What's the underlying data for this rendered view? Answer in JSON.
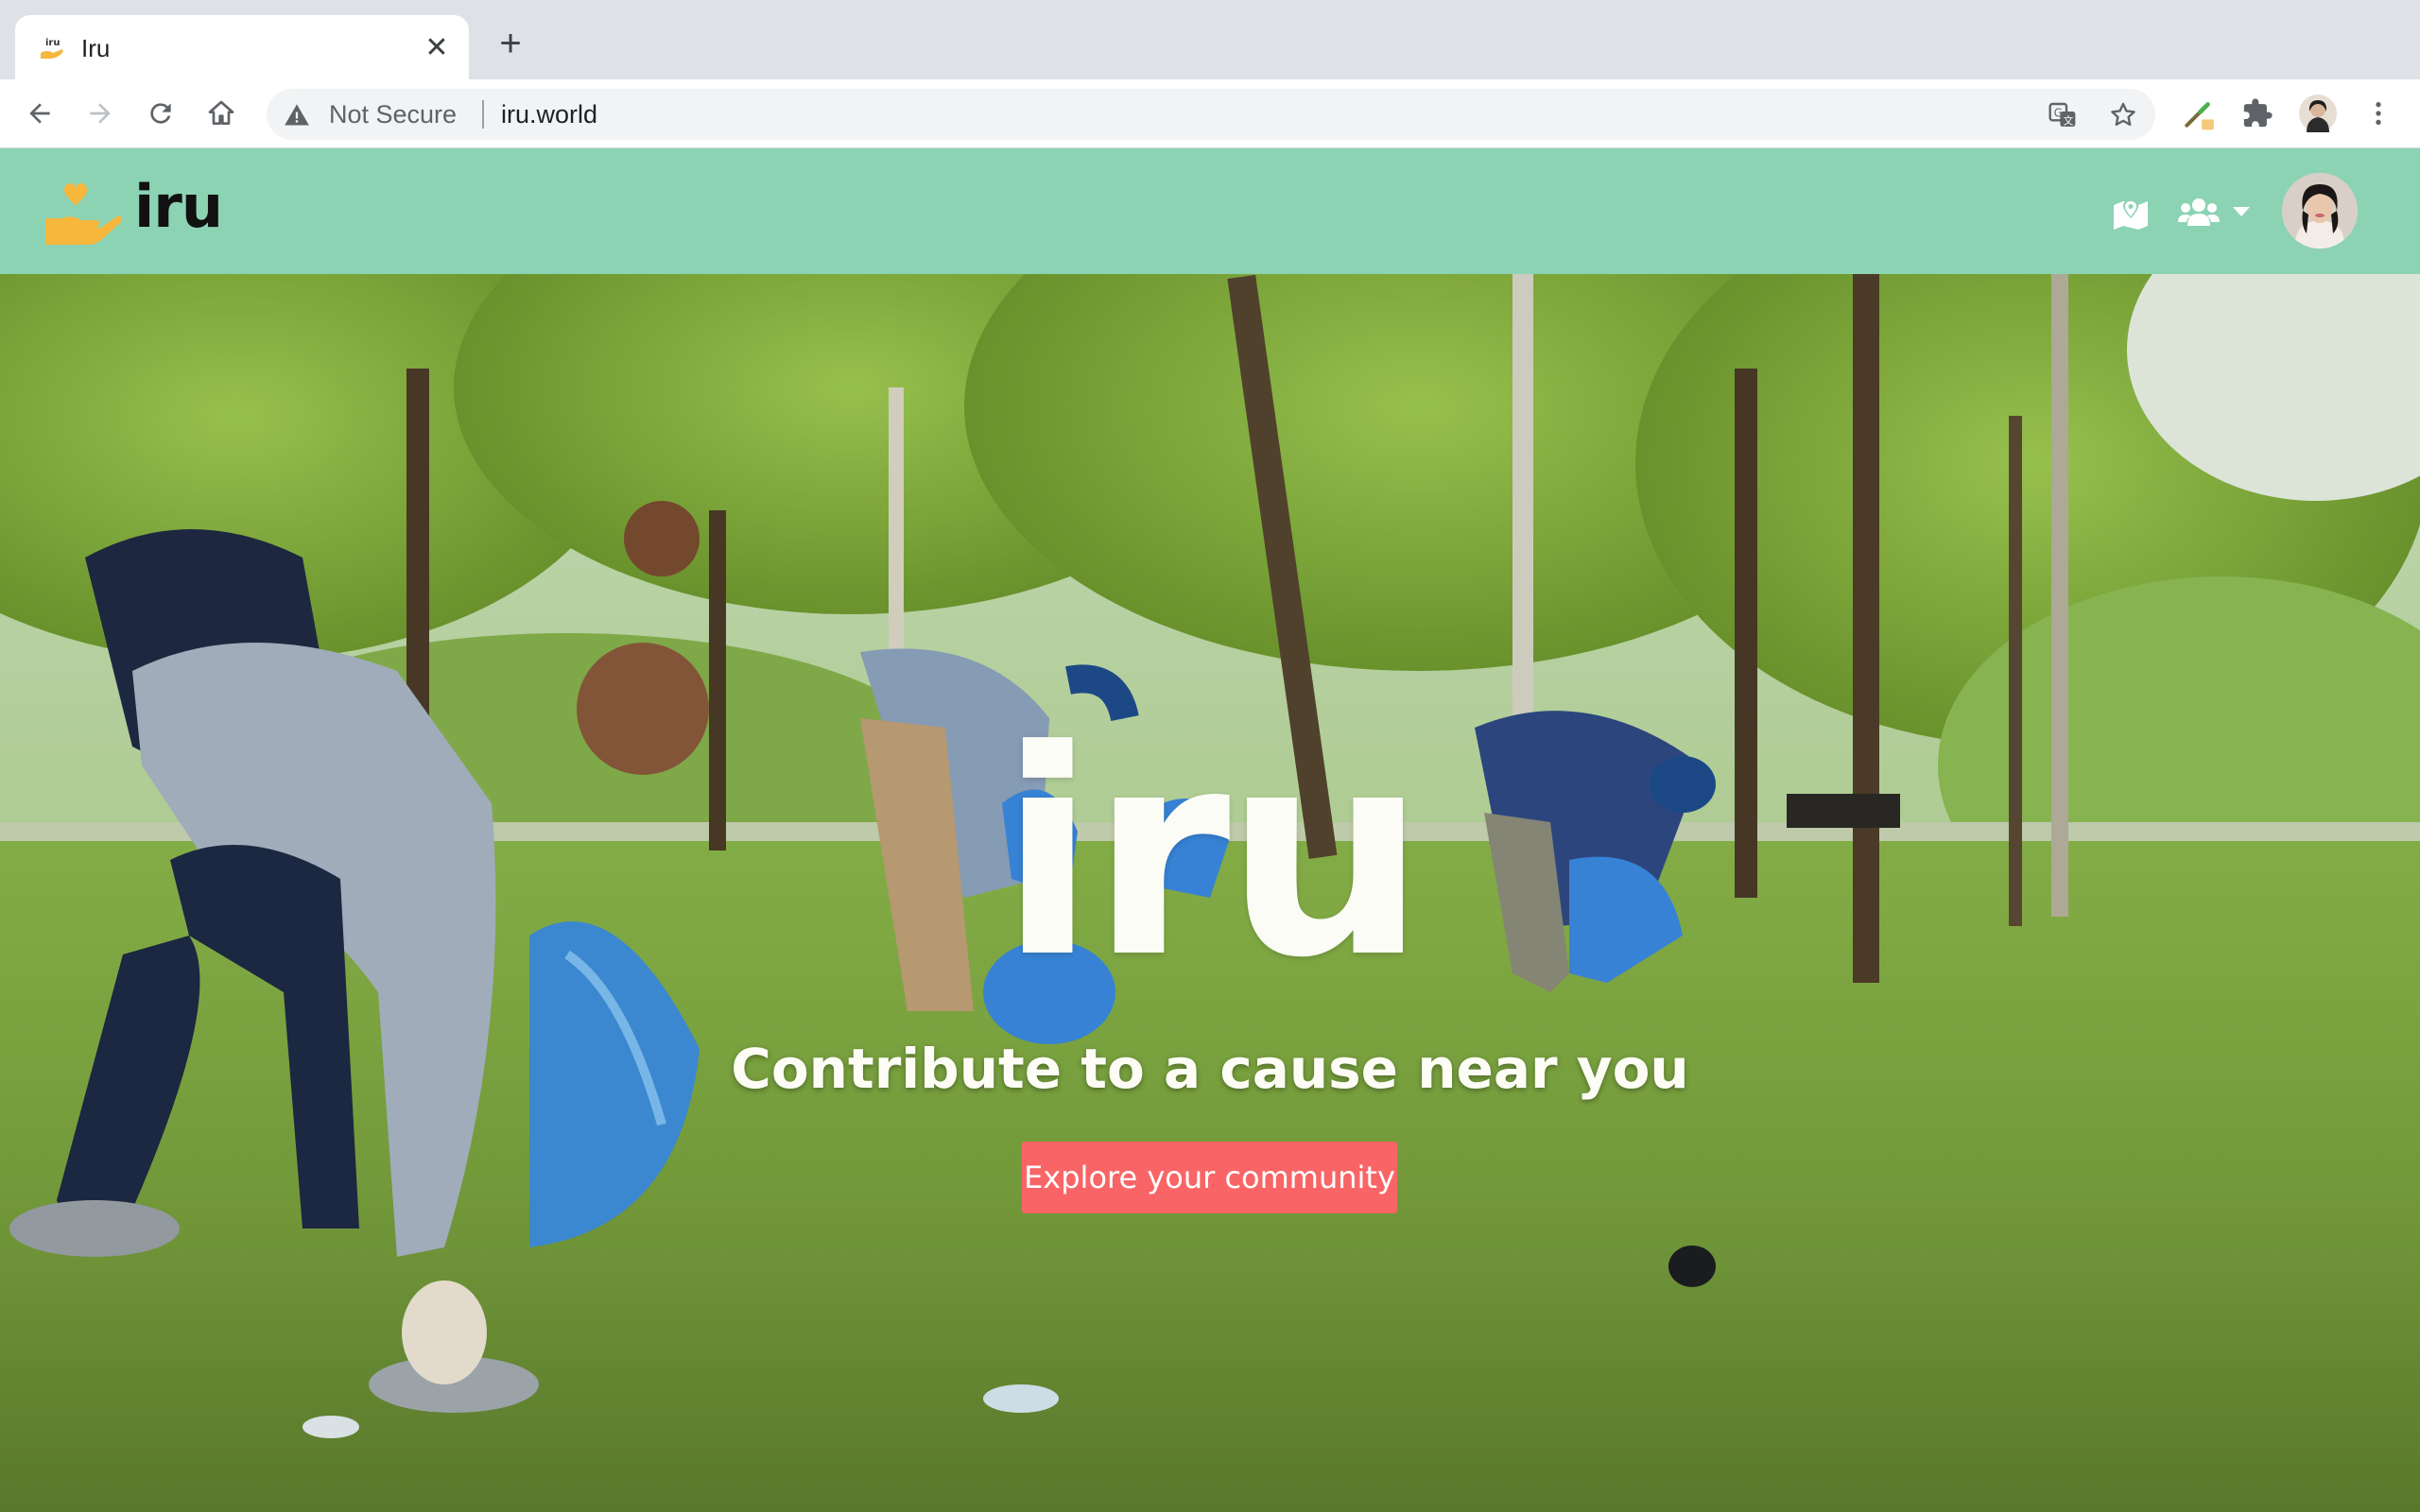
{
  "browser": {
    "tab": {
      "title": "Iru",
      "favicon": "iru-favicon",
      "close_icon": "close-icon"
    },
    "new_tab_icon": "plus-icon",
    "nav": {
      "back": "arrow-left-icon",
      "forward": "arrow-right-icon",
      "reload": "reload-icon",
      "home": "home-icon"
    },
    "address_bar": {
      "security_label": "Not Secure",
      "security_icon": "warning-icon",
      "url": "iru.world"
    },
    "actions": [
      "translate-icon",
      "bookmark-star-icon",
      "eyedropper-extension-icon",
      "puzzle-extensions-icon",
      "profile-avatar",
      "more-vert-icon"
    ]
  },
  "app": {
    "header": {
      "logo_text": "iru",
      "logo_icon": "hand-heart-icon",
      "nav_icons": [
        "map-icon",
        "users-icon",
        "caret-down-icon"
      ],
      "avatar": "user-avatar",
      "background_color": "#8cd3b4"
    },
    "hero": {
      "brand": "iru",
      "tagline": "Contribute to a cause near you",
      "cta_label": "Explore your community",
      "cta_color": "#f96566"
    }
  }
}
